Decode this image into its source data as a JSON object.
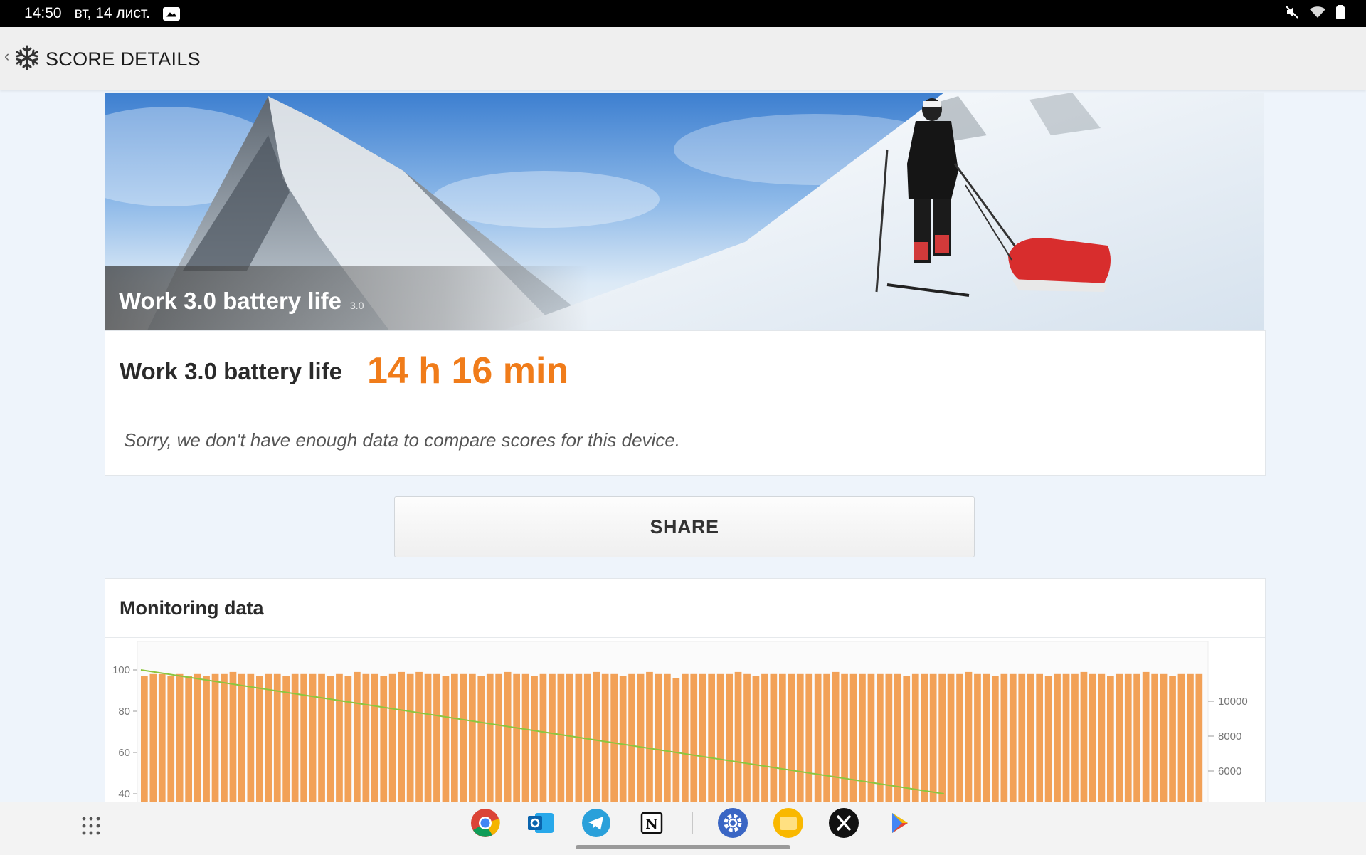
{
  "status_bar": {
    "time": "14:50",
    "date": "вт, 14 лист.",
    "icons": [
      "gallery-notification-icon",
      "mute-icon",
      "wifi-icon",
      "battery-icon"
    ]
  },
  "app_bar": {
    "title": "SCORE DETAILS",
    "logo_icon": "snowflake-logo-icon"
  },
  "hero": {
    "title": "Work 3.0 battery life",
    "version": "3.0"
  },
  "score": {
    "label": "Work 3.0 battery life",
    "value": "14 h 16 min",
    "compare_text": "Sorry, we don't have enough data to compare scores for this device."
  },
  "share": {
    "label": "SHARE"
  },
  "monitoring": {
    "title": "Monitoring data",
    "chart_data": {
      "type": "bar",
      "left_axis": {
        "ticks": [
          "100",
          "80",
          "60",
          "40"
        ]
      },
      "right_axis": {
        "ticks": [
          "10000",
          "8000",
          "6000"
        ]
      },
      "bar_color": "#f0903a",
      "line_color": "#8cc63f",
      "bar_values": [
        97,
        98,
        98,
        97,
        98,
        97,
        98,
        97,
        98,
        98,
        99,
        98,
        98,
        97,
        98,
        98,
        97,
        98,
        98,
        98,
        98,
        97,
        98,
        97,
        99,
        98,
        98,
        97,
        98,
        99,
        98,
        99,
        98,
        98,
        97,
        98,
        98,
        98,
        97,
        98,
        98,
        99,
        98,
        98,
        97,
        98,
        98,
        98,
        98,
        98,
        98,
        99,
        98,
        98,
        97,
        98,
        98,
        99,
        98,
        98,
        96,
        98,
        98,
        98,
        98,
        98,
        98,
        99,
        98,
        97,
        98,
        98,
        98,
        98,
        98,
        98,
        98,
        98,
        99,
        98,
        98,
        98,
        98,
        98,
        98,
        98,
        97,
        98,
        98,
        98,
        98,
        98,
        98,
        99,
        98,
        98,
        97,
        98,
        98,
        98,
        98,
        98,
        97,
        98,
        98,
        98,
        99,
        98,
        98,
        97,
        98,
        98,
        98,
        99,
        98,
        98,
        97,
        98,
        98,
        98
      ],
      "battery_line": {
        "start": 100,
        "end": 40
      }
    }
  },
  "taskbar": {
    "apps": [
      "chrome-icon",
      "outlook-icon",
      "telegram-icon",
      "notion-icon",
      "settings-icon",
      "files-icon",
      "x-icon",
      "play-store-icon"
    ]
  },
  "colors": {
    "accent": "#f07c1a",
    "background": "#eef4fb"
  }
}
